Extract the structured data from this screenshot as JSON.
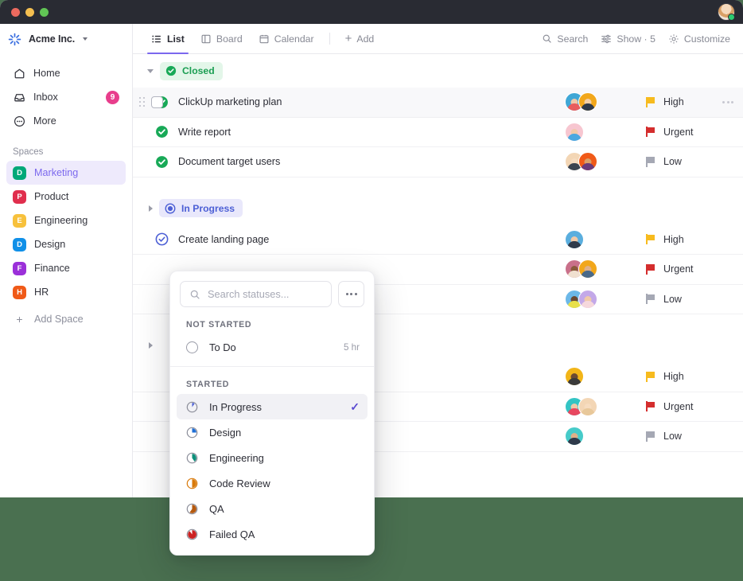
{
  "window": {
    "traffic_lights": [
      "close",
      "minimize",
      "maximize"
    ],
    "avatar_status": "online"
  },
  "sidebar": {
    "workspace": {
      "name": "Acme Inc.",
      "logo": "clickup-logo-icon"
    },
    "nav": [
      {
        "label": "Home",
        "icon": "home-icon",
        "badge": ""
      },
      {
        "label": "Inbox",
        "icon": "inbox-icon",
        "badge": "9"
      },
      {
        "label": "More",
        "icon": "more-circle-icon",
        "badge": ""
      }
    ],
    "spaces_title": "Spaces",
    "spaces": [
      {
        "label": "Marketing",
        "initial": "D",
        "color": "#00a878",
        "active": true
      },
      {
        "label": "Product",
        "initial": "P",
        "color": "#e02e4d",
        "active": false
      },
      {
        "label": "Engineering",
        "initial": "E",
        "color": "#f7c13c",
        "active": false
      },
      {
        "label": "Design",
        "initial": "D",
        "color": "#1090e8",
        "active": false
      },
      {
        "label": "Finance",
        "initial": "F",
        "color": "#9b30d9",
        "active": false
      },
      {
        "label": "HR",
        "initial": "H",
        "color": "#f05a18",
        "active": false
      }
    ],
    "add_space": {
      "label": "Add Space",
      "icon": "plus-icon"
    }
  },
  "toolbar": {
    "tabs": [
      {
        "label": "List",
        "icon": "list-icon",
        "active": true
      },
      {
        "label": "Board",
        "icon": "board-icon",
        "active": false
      },
      {
        "label": "Calendar",
        "icon": "calendar-icon",
        "active": false
      }
    ],
    "add_label": "Add",
    "add_icon": "plus-icon",
    "actions": [
      {
        "label": "Search",
        "icon": "search-icon"
      },
      {
        "label": "Show · 5",
        "icon": "sliders-icon"
      },
      {
        "label": "Customize",
        "icon": "gear-icon"
      }
    ]
  },
  "list": {
    "groups": [
      {
        "name": "Closed",
        "status_color": "#1a9e52",
        "pill_class": "pill-closed",
        "collapsed": false,
        "icon": "check-circle-icon",
        "tasks": [
          {
            "name": "ClickUp marketing plan",
            "status": "closed",
            "priority": "High",
            "priority_color": "#f7bb1e",
            "assignees": [
              "#3fa7d6",
              "#f2a71b"
            ],
            "hovered": true
          },
          {
            "name": "Write report",
            "status": "closed",
            "priority": "Urgent",
            "priority_color": "#d42d2d",
            "assignees": [
              "#f7c6d0"
            ],
            "hovered": false
          },
          {
            "name": "Document target users",
            "status": "closed",
            "priority": "Low",
            "priority_color": "#a5a8b4",
            "assignees": [
              "#f3d6b5",
              "#f05a18"
            ],
            "hovered": false
          }
        ]
      },
      {
        "name": "In Progress",
        "status_color": "#4c5fd5",
        "pill_class": "pill-inprog",
        "collapsed": true,
        "icon": "progress-circle-icon",
        "tasks": [
          {
            "name": "Create landing page",
            "status": "in-progress",
            "priority": "High",
            "priority_color": "#f7bb1e",
            "assignees": [
              "#5aaede"
            ],
            "hovered": false
          },
          {
            "name": "",
            "status": "in-progress",
            "priority": "Urgent",
            "priority_color": "#d42d2d",
            "assignees": [
              "#c9708a",
              "#f2a71b"
            ],
            "hovered": false
          },
          {
            "name": "",
            "status": "in-progress",
            "priority": "Low",
            "priority_color": "#a5a8b4",
            "assignees": [
              "#6cb8e8",
              "#c3a8e8"
            ],
            "hovered": false
          }
        ]
      },
      {
        "name": "",
        "status_color": "#9a9ca8",
        "pill_class": "",
        "collapsed": true,
        "icon": "",
        "tasks": [
          {
            "name": "",
            "status": "",
            "priority": "High",
            "priority_color": "#f7bb1e",
            "assignees": [
              "#f2b518"
            ],
            "hovered": false
          },
          {
            "name": "",
            "status": "",
            "priority": "Urgent",
            "priority_color": "#d42d2d",
            "assignees": [
              "#33c4c4",
              "#f3d6b5"
            ],
            "hovered": false
          },
          {
            "name": "",
            "status": "",
            "priority": "Low",
            "priority_color": "#a5a8b4",
            "assignees": [
              "#46cbc9"
            ],
            "hovered": false
          }
        ]
      }
    ]
  },
  "dropdown": {
    "search_placeholder": "Search statuses...",
    "search_value": "",
    "more_label": "more-options",
    "sections": [
      {
        "title": "NOT STARTED",
        "items": [
          {
            "label": "To Do",
            "meta": "5 hr",
            "selected": false,
            "icon": "empty-circle-icon",
            "color": "#9a9ca8",
            "progress": 0
          }
        ]
      },
      {
        "title": "STARTED",
        "items": [
          {
            "label": "In Progress",
            "meta": "",
            "selected": true,
            "icon": "progress-pie-icon",
            "color": "#4c5fd5",
            "progress": 12
          },
          {
            "label": "Design",
            "meta": "",
            "selected": false,
            "icon": "progress-pie-icon",
            "color": "#1f6fd6",
            "progress": 25
          },
          {
            "label": "Engineering",
            "meta": "",
            "selected": false,
            "icon": "progress-pie-icon",
            "color": "#0e8f7a",
            "progress": 40
          },
          {
            "label": "Code Review",
            "meta": "",
            "selected": false,
            "icon": "progress-pie-icon",
            "color": "#d97a0a",
            "progress": 50
          },
          {
            "label": "QA",
            "meta": "",
            "selected": false,
            "icon": "progress-pie-icon",
            "color": "#b55a10",
            "progress": 70
          },
          {
            "label": "Failed QA",
            "meta": "",
            "selected": false,
            "icon": "progress-pie-icon",
            "color": "#cc2222",
            "progress": 85
          }
        ]
      }
    ],
    "check_symbol": "✓"
  },
  "colors": {
    "accent": "#7b68ee",
    "background_green": "#4a7050",
    "titlebar": "#292b33",
    "closed_green": "#1a9e52",
    "inprogress_blue": "#4c5fd5"
  }
}
